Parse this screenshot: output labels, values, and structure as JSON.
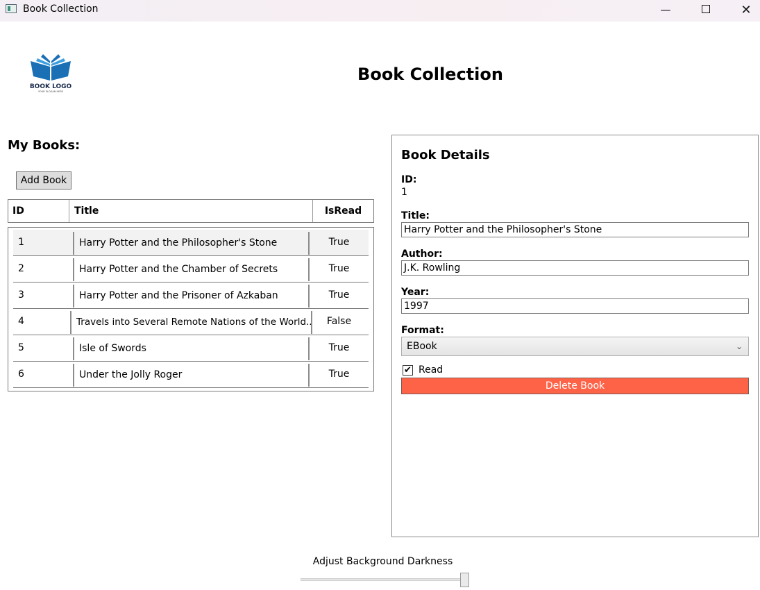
{
  "window": {
    "title": "Book Collection",
    "min": "—",
    "close": "✕"
  },
  "logo": {
    "text": "BOOK LOGO",
    "slogan": "YOUR SLOGAN HERE",
    "color": "#1a6fb5"
  },
  "header": {
    "title": "Book Collection"
  },
  "books": {
    "section_title": "My Books:",
    "add_label": "Add Book",
    "columns": {
      "id": "ID",
      "title": "Title",
      "isread": "IsRead"
    },
    "rows": [
      {
        "id": "1",
        "title": "Harry Potter and the Philosopher's Stone",
        "isread": "True"
      },
      {
        "id": "2",
        "title": "Harry Potter and the Chamber of Secrets",
        "isread": "True"
      },
      {
        "id": "3",
        "title": "Harry Potter and the Prisoner of Azkaban",
        "isread": "True"
      },
      {
        "id": "4",
        "title": "Travels into Several Remote Nations of the World...",
        "isread": "False"
      },
      {
        "id": "5",
        "title": "Isle of Swords",
        "isread": "True"
      },
      {
        "id": "6",
        "title": "Under the Jolly Roger",
        "isread": "True"
      }
    ]
  },
  "details": {
    "title": "Book Details",
    "id_label": "ID:",
    "id_value": "1",
    "title_label": "Title:",
    "title_value": "Harry Potter and the Philosopher's Stone",
    "author_label": "Author:",
    "author_value": "J.K. Rowling",
    "year_label": "Year:",
    "year_value": "1997",
    "format_label": "Format:",
    "format_value": "EBook",
    "read_label": "Read",
    "read_checked": true,
    "delete_label": "Delete Book",
    "delete_color": "#ff6347"
  },
  "slider": {
    "label": "Adjust Background Darkness",
    "value": 0.95
  }
}
